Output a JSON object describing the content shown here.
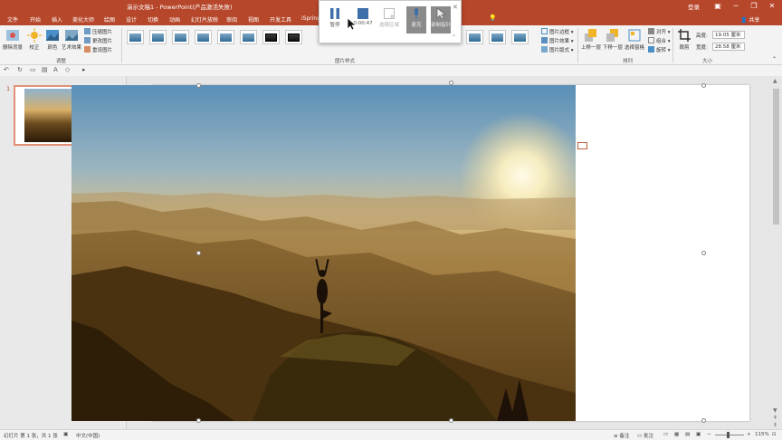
{
  "titlebar": {
    "title": "演示文稿1 - PowerPoint(产品激活失败)",
    "login": "登录",
    "colors": {
      "accent": "#b7472a"
    }
  },
  "tabs": [
    {
      "label": "文件"
    },
    {
      "label": "开始"
    },
    {
      "label": "插入"
    },
    {
      "label": "美化大师"
    },
    {
      "label": "绘图"
    },
    {
      "label": "设计"
    },
    {
      "label": "切换"
    },
    {
      "label": "动画"
    },
    {
      "label": "幻灯片放映"
    },
    {
      "label": "审阅"
    },
    {
      "label": "视图"
    },
    {
      "label": "开发工具"
    },
    {
      "label": "iSpring"
    }
  ],
  "share": {
    "label": "共享"
  },
  "ribbon": {
    "adjust": {
      "remove_bg": "删除背景",
      "correct": "校正",
      "color": "颜色",
      "artistic": "艺术效果",
      "compress": "压缩图片",
      "change": "更改图片",
      "reset": "重设图片",
      "group": "调整"
    },
    "styles": {
      "group": "图片样式"
    },
    "picture": {
      "border": "图片边框",
      "effects": "图片效果",
      "layout": "图片版式"
    },
    "arrange": {
      "forward": "上移一层",
      "backward": "下移一层",
      "selection": "选择窗格",
      "align": "对齐",
      "group_obj": "组合",
      "rotate": "旋转",
      "group": "排列"
    },
    "size": {
      "crop": "裁剪",
      "height_label": "高度:",
      "height": "19.05 厘米",
      "width_label": "宽度:",
      "width": "28.58 厘米",
      "group": "大小"
    }
  },
  "recorder": {
    "pause": "暂停",
    "time": "0:00:47",
    "add_slide": "选择区域",
    "mic": "麦克",
    "pointer": "录制指针"
  },
  "slides_panel": {
    "slide_number": "1"
  },
  "statusbar": {
    "slide_info": "幻灯片 第 1 张，共 1 张",
    "language": "中文(中国)",
    "notes": "备注",
    "comments": "批注",
    "zoom": "115%"
  }
}
